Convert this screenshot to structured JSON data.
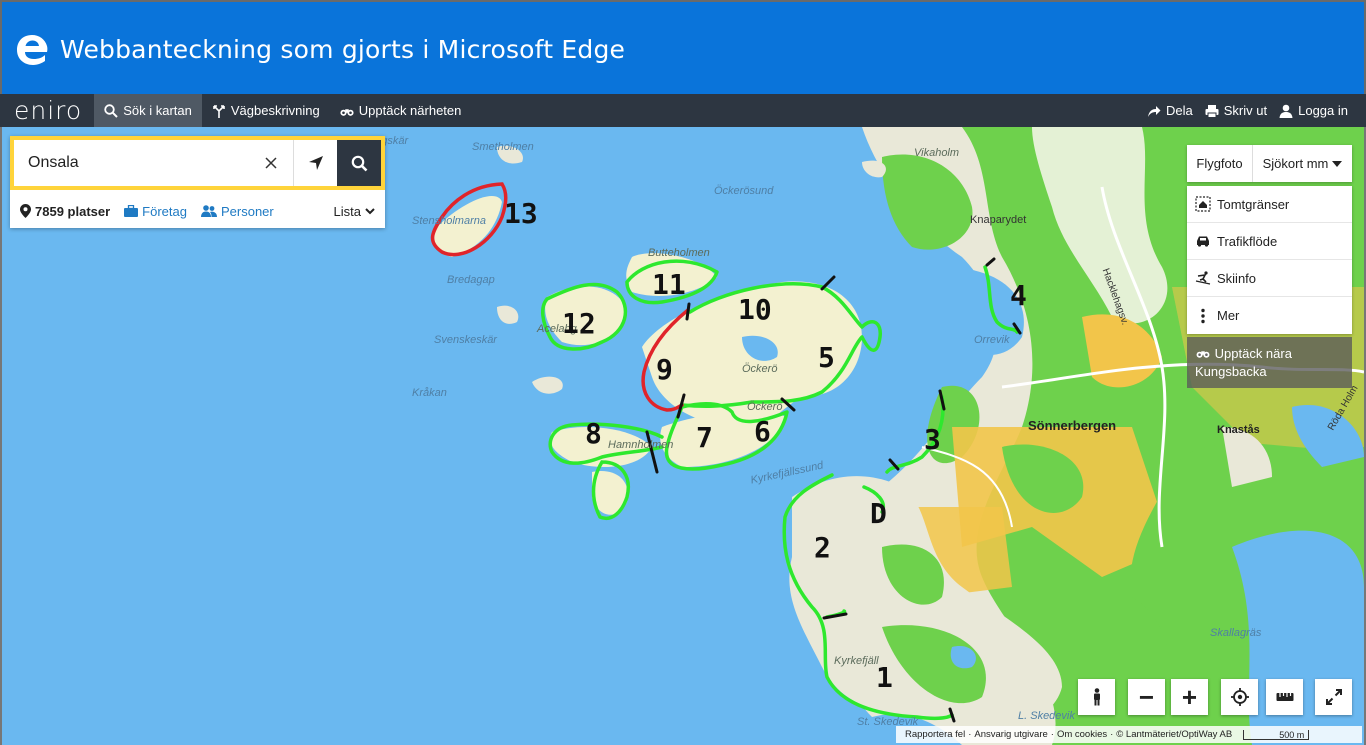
{
  "window": {
    "title": "Webbanteckning som gjorts i Microsoft Edge"
  },
  "nav": {
    "brand": "eniro",
    "items": [
      {
        "label": "Sök i kartan",
        "icon": "search-icon",
        "active": true
      },
      {
        "label": "Vägbeskrivning",
        "icon": "directions-icon"
      },
      {
        "label": "Upptäck närheten",
        "icon": "binoculars-icon"
      }
    ],
    "right": [
      {
        "label": "Dela",
        "icon": "share-icon"
      },
      {
        "label": "Skriv ut",
        "icon": "printer-icon"
      },
      {
        "label": "Logga in",
        "icon": "user-icon"
      }
    ]
  },
  "search": {
    "value": "Onsala",
    "count": "7859 platser",
    "companies": "Företag",
    "persons": "Personer",
    "list": "Lista"
  },
  "layers": {
    "photo": "Flygfoto",
    "map_type": "Sjökort mm",
    "items": [
      {
        "label": "Tomtgränser",
        "icon": "property-boundary-icon"
      },
      {
        "label": "Trafikflöde",
        "icon": "car-icon"
      },
      {
        "label": "Skiinfo",
        "icon": "skier-icon"
      },
      {
        "label": "Mer",
        "icon": "more-vertical-icon"
      }
    ],
    "discover": "Upptäck nära Kungsbacka"
  },
  "map": {
    "places": {
      "smetholmen": "Smetholmen",
      "angskar": "ängskär",
      "vikaholm": "Vikaholm",
      "ockerosund": "Öckerösund",
      "knaparydet": "Knaparydet",
      "stensholmarna": "Stensholmarna",
      "bredagap": "Bredagap",
      "butteholmen": "Butteholmen",
      "hacklehagsv": "Hacklehagsv.",
      "acelahg": "Acelahg",
      "svenskeskar": "Svenskeskär",
      "orrevik": "Orrevik",
      "ockero1": "Öckerö",
      "ockero2": "Öckerö",
      "krakan": "Kråkan",
      "sonnerbergen": "Sönnerbergen",
      "knastas": "Knastås",
      "rodaholmen": "Röda Holm",
      "hamnholmen": "Hamnholmen",
      "kyrkefjallssund": "Kyrkefjällssund",
      "skallagras": "Skallagräs",
      "kyrkefjall": "Kyrkefjäll",
      "skedevik1": "St. Skedevik",
      "skedevik2": "L. Skedevik"
    },
    "annotations": [
      "1",
      "2",
      "3",
      "4",
      "5",
      "6",
      "7",
      "8",
      "9",
      "10",
      "11",
      "12",
      "13",
      "D"
    ]
  },
  "controls": {
    "zoom_out": "−",
    "zoom_in": "+",
    "icons": [
      "pegman-icon",
      "zoom-out-icon",
      "zoom-in-icon",
      "locate-icon",
      "ruler-icon",
      "fullscreen-icon"
    ]
  },
  "attribution": {
    "report": "Rapportera fel",
    "responsible": "Ansvarig utgivare",
    "cookies": "Om cookies",
    "copyright": "© Lantmäteriet/OptiWay AB",
    "scale": "500 m"
  },
  "colors": {
    "edge_blue": "#0a74da",
    "nav_bg": "#2d3641",
    "water": "#6ab8f0",
    "search_yellow": "#ffd43a",
    "link": "#1f7ac3",
    "annotation_green": "#2ee82e",
    "annotation_red": "#e0242a"
  }
}
